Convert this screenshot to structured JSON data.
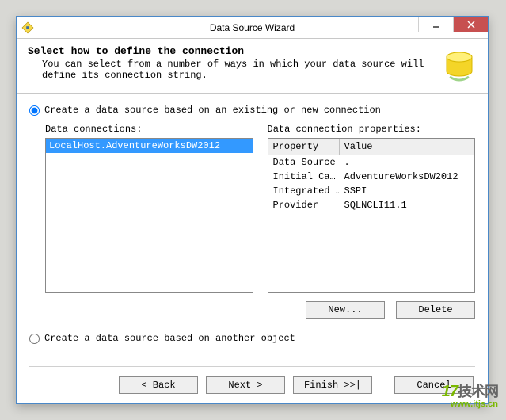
{
  "window": {
    "title": "Data Source Wizard"
  },
  "header": {
    "title": "Select how to define the connection",
    "subtitle": "You can select from a number of ways in which your data source will define its connection string."
  },
  "options": {
    "opt1": "Create a data source based on an existing or new connection",
    "opt2": "Create a data source based on another object"
  },
  "left": {
    "label": "Data connections:",
    "selected_item": "LocalHost.AdventureWorksDW2012"
  },
  "right": {
    "label": "Data connection properties:",
    "head_property": "Property",
    "head_value": "Value",
    "rows": [
      {
        "k": "Data Source",
        "v": "."
      },
      {
        "k": "Initial Ca…",
        "v": "AdventureWorksDW2012"
      },
      {
        "k": "Integrated …",
        "v": "SSPI"
      },
      {
        "k": "Provider",
        "v": "SQLNCLI11.1"
      }
    ]
  },
  "buttons": {
    "new": "New...",
    "delete": "Delete",
    "back": "< Back",
    "next": "Next >",
    "finish": "Finish >>|",
    "cancel": "Cancel"
  },
  "watermark": {
    "brand_num": "17",
    "brand_cn": "技术网",
    "url": "www.itjs.cn"
  }
}
